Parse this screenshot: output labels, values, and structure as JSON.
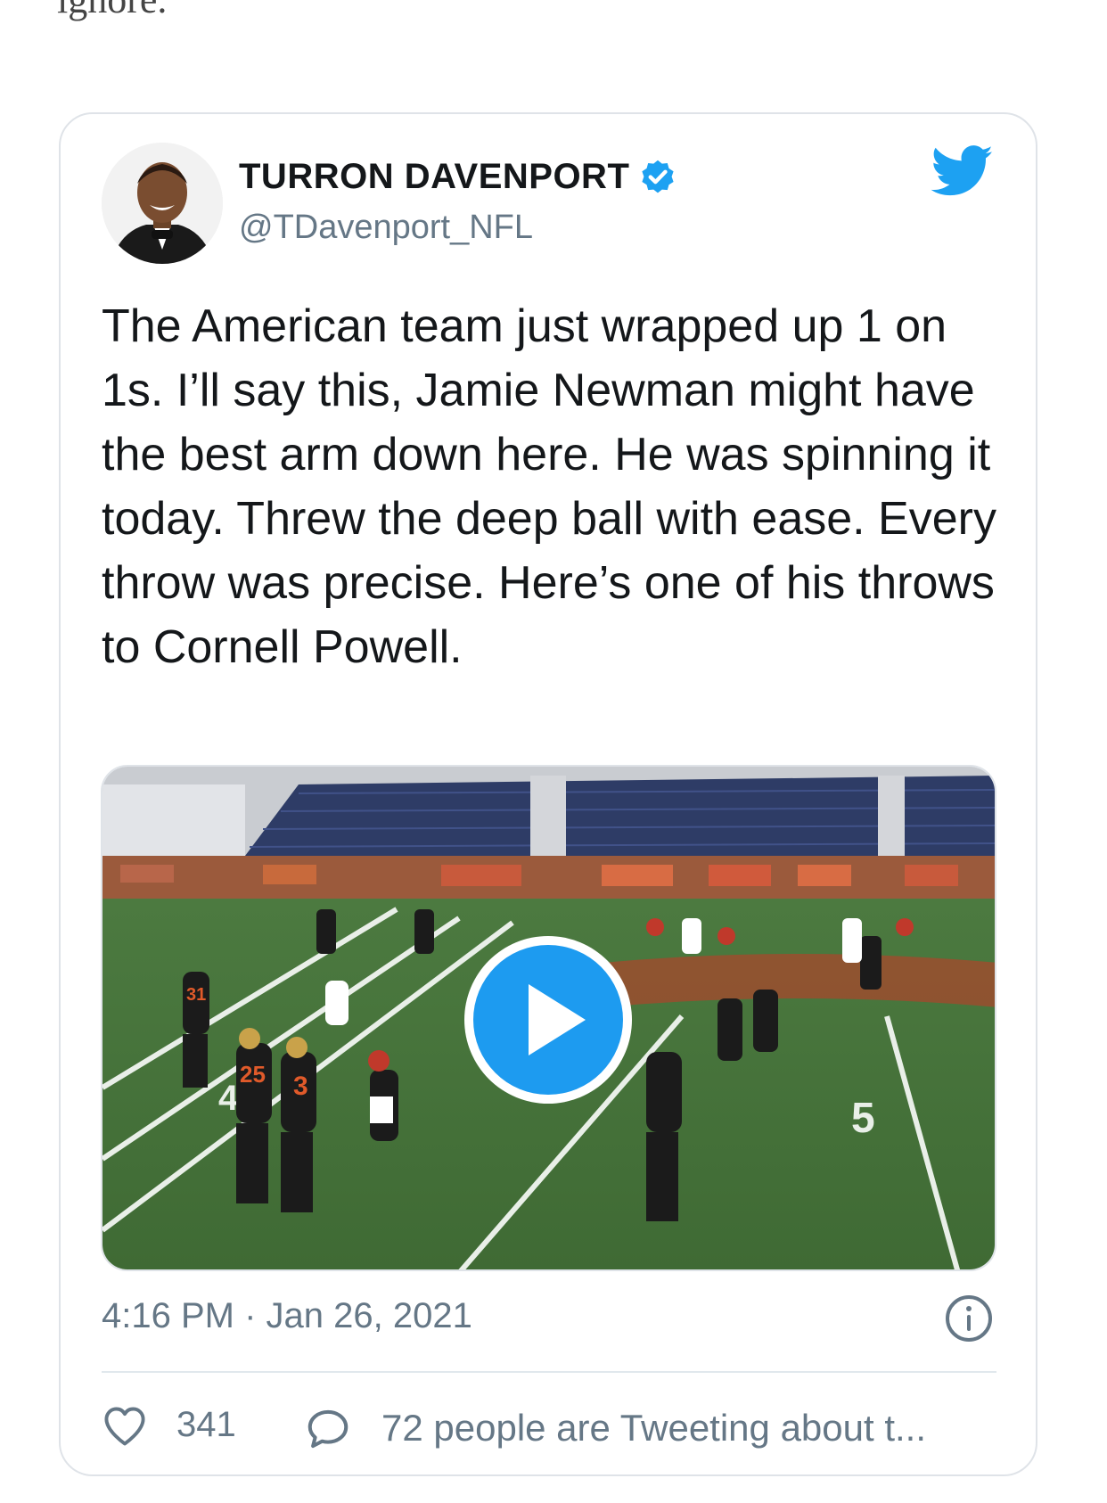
{
  "page": {
    "top_text": "ignore."
  },
  "tweet": {
    "author_name": "TURRON DAVENPORT",
    "handle": "@TDavenport_NFL",
    "verified": true,
    "text": "The American team just wrapped up 1 on 1s. I’ll say this, Jamie Newman might have the best arm down here. He was spinning it today. Threw the deep ball with ease. Every throw was precise. Here’s one of his throws to Cornell Powell.",
    "timestamp": "4:16 PM · Jan 26, 2021",
    "likes": "341",
    "tweeting_text": "72 people are Tweeting about t...",
    "media": {
      "type": "video",
      "jerseys": [
        "25",
        "3",
        "31"
      ]
    }
  },
  "icons": {
    "brand": "twitter-bird-icon",
    "verified": "verified-badge-icon",
    "play": "play-icon",
    "info": "info-icon",
    "like": "heart-icon",
    "reply": "speech-bubble-icon"
  },
  "colors": {
    "twitter_blue": "#1da1f2",
    "text_primary": "#14171a",
    "text_secondary": "#657786",
    "border": "#dfe3e8"
  }
}
